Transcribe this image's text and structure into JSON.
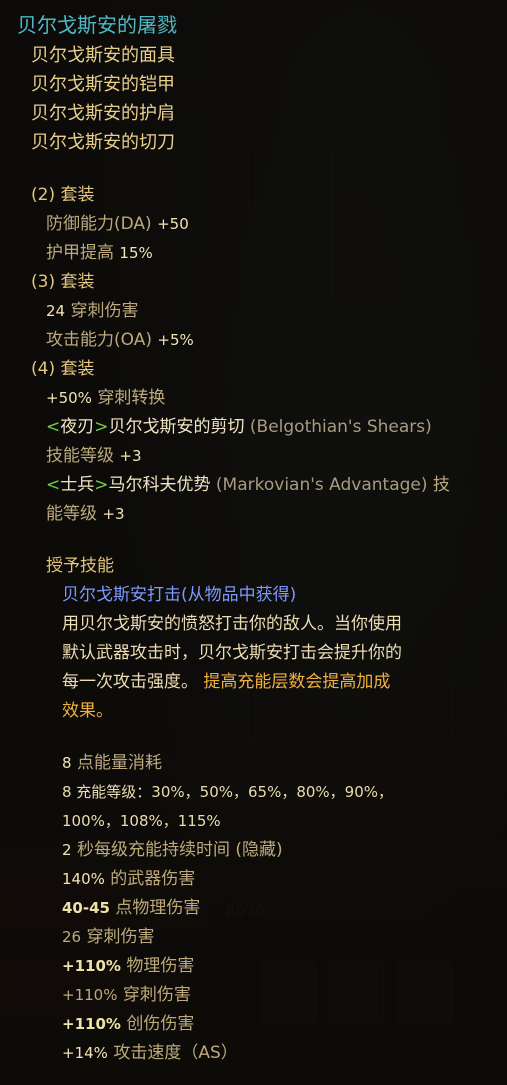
{
  "tooltip": {
    "set_title": "贝尔戈斯安的屠戮",
    "set_items": [
      "贝尔戈斯安的面具",
      "贝尔戈斯安的铠甲",
      "贝尔戈斯安的护肩",
      "贝尔戈斯安的切刀"
    ],
    "bonus2": {
      "header": "(2) 套装",
      "line1_label": "防御能力(DA)",
      "line1_value": "+50",
      "line2_label": "护甲提高",
      "line2_value": "15%"
    },
    "bonus3": {
      "header": "(3) 套装",
      "line1_value": "24",
      "line1_label": "穿刺伤害",
      "line2_label": "攻击能力(OA)",
      "line2_value": "+5%"
    },
    "bonus4": {
      "header": "(4) 套装",
      "line1_value": "+50%",
      "line1_label": "穿刺转换",
      "skill1_open": "<",
      "skill1_tag": "夜刃",
      "skill1_close": ">",
      "skill1_name": "贝尔戈斯安的剪切",
      "skill1_eng": "(Belgothian's Shears)",
      "skill1_level_label": "技能等级",
      "skill1_level_value": "+3",
      "skill2_open": "<",
      "skill2_tag": "士兵",
      "skill2_close": ">",
      "skill2_name": "马尔科夫优势",
      "skill2_eng": "(Markovian's Advantage)",
      "skill2_level_label_a": "技",
      "skill2_level_label_b": "能等级",
      "skill2_level_value": "+3"
    },
    "granted": {
      "header": "授予技能",
      "skill_name": "贝尔戈斯安打击(从物品中获得)",
      "desc_line1": "用贝尔戈斯安的愤怒打击你的敌人。当你使用",
      "desc_line2": "默认武器攻击时，贝尔戈斯安打击会提升你的",
      "desc_line3a": "每一次攻击强度。",
      "desc_line3b": "提高充能层数会提高加成",
      "desc_line4": "效果。"
    },
    "skill_stats": {
      "energy_value": "8",
      "energy_label": "点能量消耗",
      "charge_line1": "8 充能等级：30%，50%，65%，80%，90%，",
      "charge_line2": "100%，108%，115%",
      "duration_value": "2",
      "duration_label": "秒每级充能持续时间 (隐藏)",
      "weapon_value": "140%",
      "weapon_label": "的武器伤害",
      "phys_value": "40-45",
      "phys_label": "点物理伤害",
      "pierce_value": "26",
      "pierce_label": "穿刺伤害",
      "phys_pct_value": "+110%",
      "phys_pct_label": "物理伤害",
      "pierce_pct_value": "+110%",
      "pierce_pct_label": "穿刺伤害",
      "bleed_value": "+110%",
      "bleed_label": "创伤伤害",
      "speed_value": "+14%",
      "speed_label": "攻击速度（AS）"
    }
  },
  "background": {
    "ghost_number": "8070"
  }
}
